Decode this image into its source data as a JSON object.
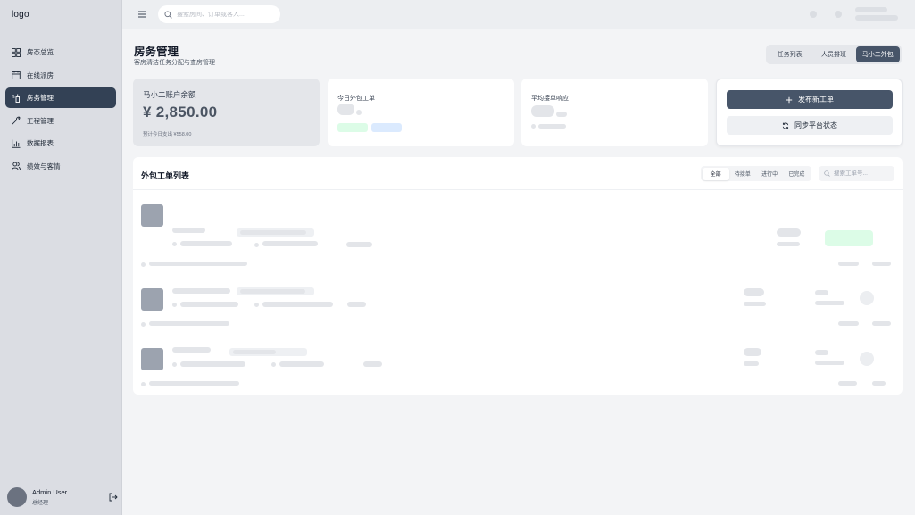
{
  "sidebar": {
    "logo": "logo",
    "items": [
      {
        "label": "房态总览",
        "icon": "dashboard-icon"
      },
      {
        "label": "在线派房",
        "icon": "calendar-icon"
      },
      {
        "label": "房务管理",
        "icon": "housekeeping-icon",
        "active": true
      },
      {
        "label": "工程管理",
        "icon": "wrench-icon"
      },
      {
        "label": "数据报表",
        "icon": "bar-chart-icon"
      },
      {
        "label": "绩效与客情",
        "icon": "users-icon"
      }
    ],
    "user": {
      "name": "Admin User",
      "role": "总经理"
    }
  },
  "topbar": {
    "search_placeholder": "搜索房间、订单或客人..."
  },
  "header": {
    "title": "房务管理",
    "subtitle": "客房清洁任务分配与查房管理",
    "tabs": [
      {
        "label": "任务列表"
      },
      {
        "label": "人员排班"
      },
      {
        "label": "马小二外包",
        "active": true
      }
    ]
  },
  "stats": {
    "balance_label": "马小二账户余额",
    "balance_value": "¥ 2,850.00",
    "balance_note": "预计今日支出 ¥558.00",
    "today_orders_label": "今日外包工单",
    "avg_response_label": "平均接单响应"
  },
  "actions": {
    "publish_label": "发布新工单",
    "sync_label": "同步平台状态"
  },
  "list": {
    "title": "外包工单列表",
    "filters": [
      "全部",
      "待接单",
      "进行中",
      "已完成"
    ],
    "search_placeholder": "搜索工单号..."
  },
  "colors": {
    "accent": "#475569",
    "sidebar_active": "#334155",
    "success_soft": "#dcfce7",
    "info_soft": "#dbeafe"
  }
}
